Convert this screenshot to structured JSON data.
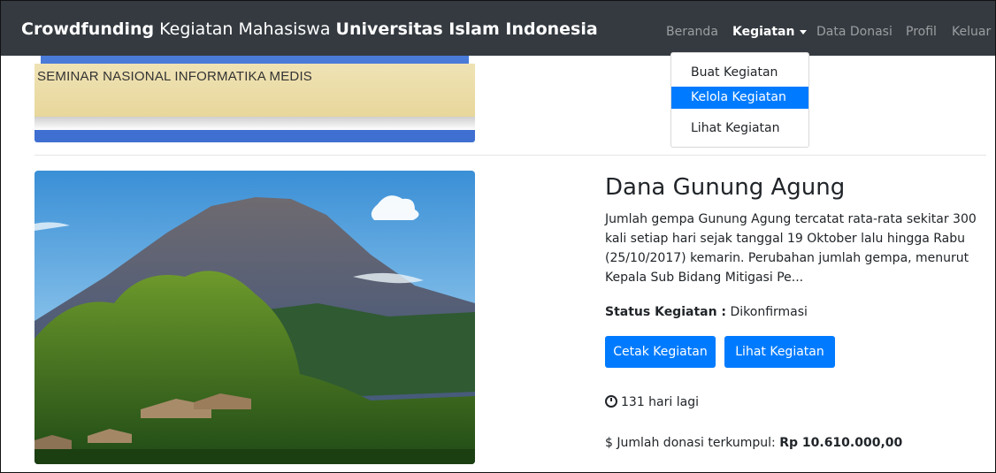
{
  "navbar": {
    "brand_bold1": "Crowdfunding",
    "brand_mid": " Kegiatan Mahasiswa ",
    "brand_bold2": "Universitas Islam Indonesia",
    "items": [
      {
        "label": "Beranda"
      },
      {
        "label": "Kegiatan"
      },
      {
        "label": "Data Donasi"
      },
      {
        "label": "Profil"
      },
      {
        "label": "Keluar"
      }
    ],
    "dropdown": [
      {
        "label": "Buat Kegiatan"
      },
      {
        "label": "Kelola Kegiatan"
      },
      {
        "label": "Lihat Kegiatan"
      }
    ],
    "active_color": "#007bff",
    "bg_color": "#343a40"
  },
  "prev_card": {
    "banner_text": "SEMINAR NASIONAL INFORMATIKA MEDIS"
  },
  "activity": {
    "title": "Dana Gunung Agung",
    "description": "Jumlah gempa Gunung Agung tercatat rata-rata sekitar 300 kali setiap hari sejak tanggal 19 Oktober lalu hingga Rabu (25/10/2017) kemarin. Perubahan jumlah gempa, menurut Kepala Sub Bidang Mitigasi Pe...",
    "status_label": "Status Kegiatan :",
    "status_value": " Dikonfirmasi",
    "buttons": {
      "print": "Cetak Kegiatan",
      "view": "Lihat Kegiatan"
    },
    "days_left": "131 hari lagi",
    "donation_prefix": "$",
    "donation_label": " Jumlah donasi terkumpul: ",
    "donation_amount": "Rp 10.610.000,00"
  }
}
